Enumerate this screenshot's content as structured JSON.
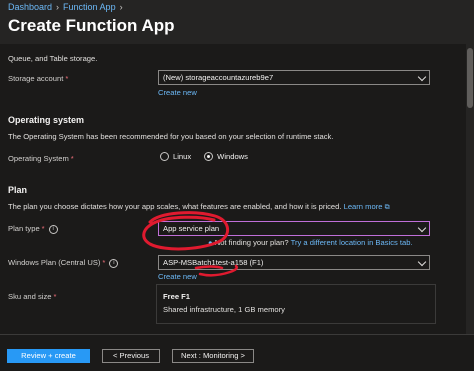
{
  "breadcrumb": [
    "Dashboard",
    "Function App"
  ],
  "page_title": "Create Function App",
  "storage_intro_text": "Queue, and Table storage.",
  "storage": {
    "label": "Storage account",
    "value": "(New) storageaccountazureb9e7",
    "create_new": "Create new"
  },
  "os": {
    "heading": "Operating system",
    "description": "The Operating System has been recommended for you based on your selection of runtime stack.",
    "label": "Operating System",
    "options": [
      {
        "label": "Linux",
        "checked": false
      },
      {
        "label": "Windows",
        "checked": true
      }
    ]
  },
  "plan": {
    "heading": "Plan",
    "description": "The plan you choose dictates how your app scales, what features are enabled, and how it is priced.",
    "learn_more": "Learn more",
    "type_label": "Plan type",
    "type_value": "App service plan",
    "hint": "Not finding your plan?",
    "hint_link": "Try a different location in Basics tab.",
    "windows_plan_label": "Windows Plan (Central US)",
    "windows_plan_value": "ASP-MSBatch1test-a158 (F1)",
    "create_new": "Create new",
    "sku_label": "Sku and size",
    "sku_name": "Free F1",
    "sku_detail": "Shared infrastructure, 1 GB memory"
  },
  "footer": {
    "review_create": "Review + create",
    "previous": "< Previous",
    "next": "Next : Monitoring >"
  },
  "colors": {
    "link": "#6cb8f6",
    "primary_button": "#2899f5",
    "annotation": "#e01a2f",
    "focus_border": "#c06fd8"
  }
}
